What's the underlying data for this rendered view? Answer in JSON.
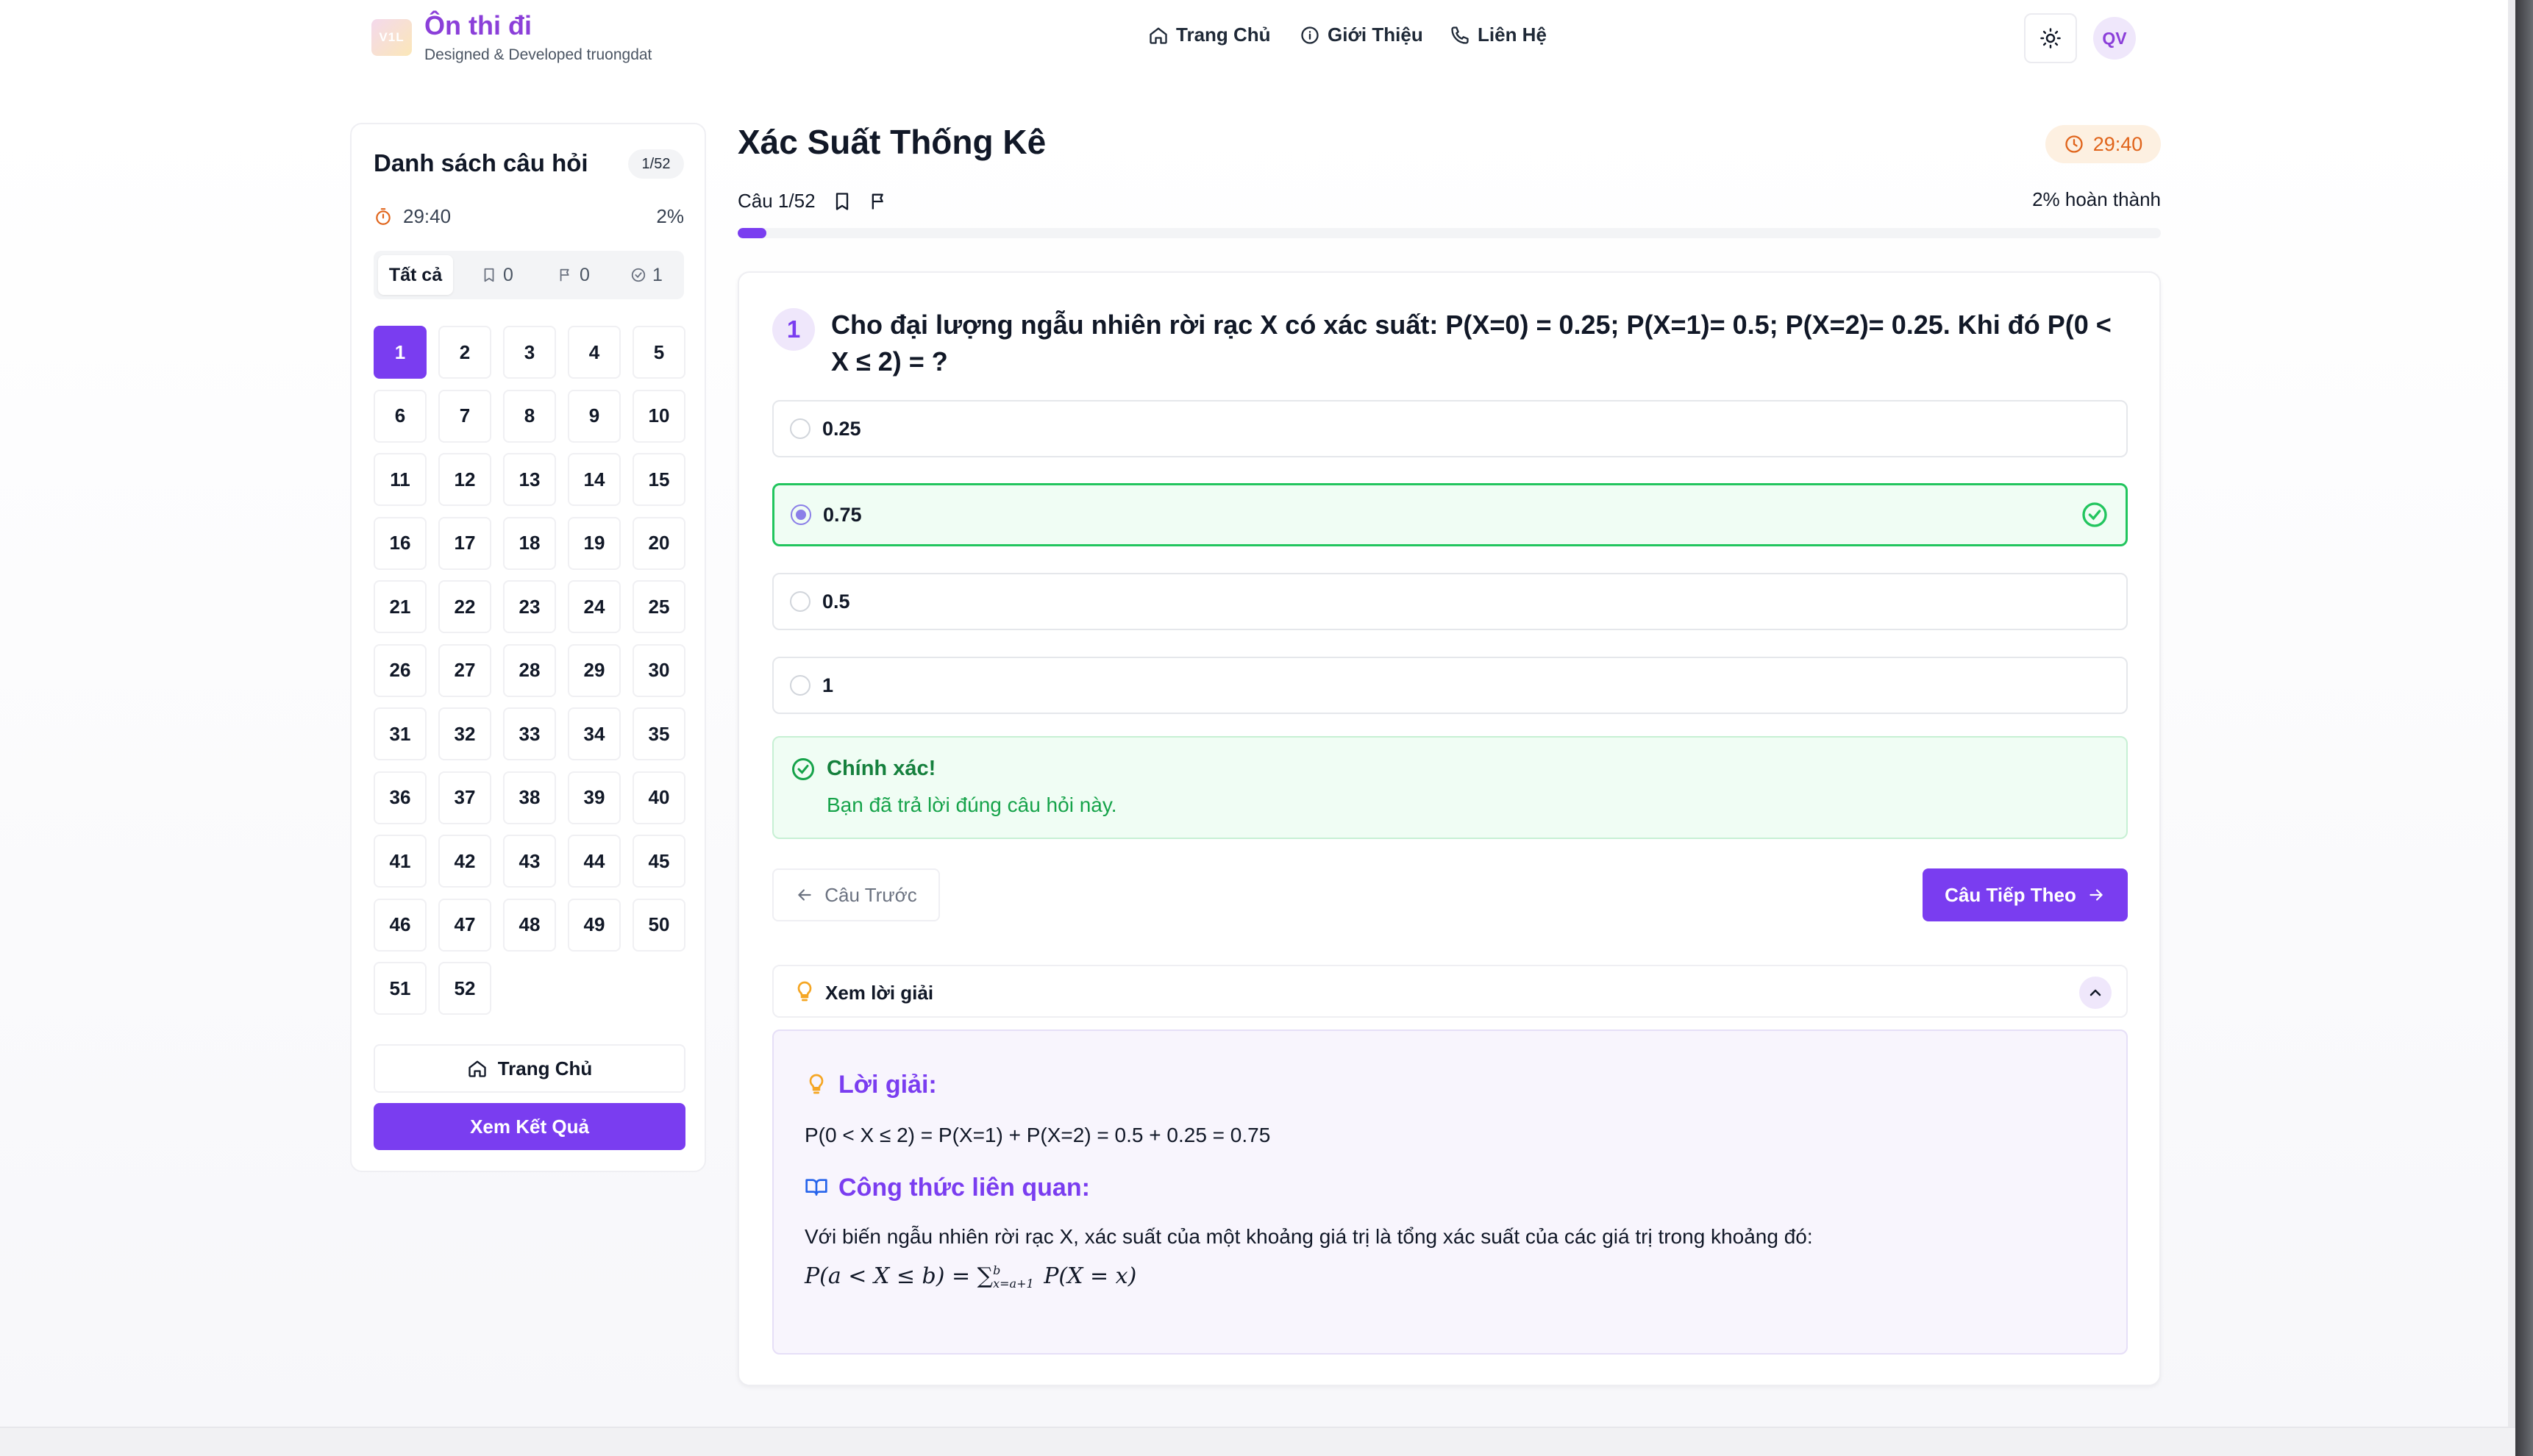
{
  "header": {
    "logo_text": "V1L",
    "brand_title": "Ôn thi đi",
    "brand_sub": "Designed & Developed truongdat",
    "nav": [
      "Trang Chủ",
      "Giới Thiệu",
      "Liên Hệ"
    ],
    "avatar": "QV"
  },
  "sidebar": {
    "title": "Danh sách câu hỏi",
    "count_badge": "1/52",
    "timer": "29:40",
    "percent": "2%",
    "filters": {
      "all_label": "Tất cả",
      "bookmarked_count": "0",
      "flagged_count": "0",
      "answered_count": "1"
    },
    "questions": [
      "1",
      "2",
      "3",
      "4",
      "5",
      "6",
      "7",
      "8",
      "9",
      "10",
      "11",
      "12",
      "13",
      "14",
      "15",
      "16",
      "17",
      "18",
      "19",
      "20",
      "21",
      "22",
      "23",
      "24",
      "25",
      "26",
      "27",
      "28",
      "29",
      "30",
      "31",
      "32",
      "33",
      "34",
      "35",
      "36",
      "37",
      "38",
      "39",
      "40",
      "41",
      "42",
      "43",
      "44",
      "45",
      "46",
      "47",
      "48",
      "49",
      "50",
      "51",
      "52"
    ],
    "active_question": 1,
    "home_label": "Trang Chủ",
    "result_label": "Xem Kết Quả"
  },
  "main": {
    "title": "Xác Suất Thống Kê",
    "timer": "29:40",
    "question_label": "Câu 1/52",
    "progress_text": "2% hoàn thành",
    "progress_fraction": 0.02,
    "question_number": "1",
    "question_text": "Cho đại lượng ngẫu nhiên rời rạc X có xác suất: P(X=0) = 0.25; P(X=1)= 0.5; P(X=2)= 0.25. Khi đó P(0 < X ≤ 2) = ?",
    "options": [
      "0.25",
      "0.75",
      "0.5",
      "1"
    ],
    "selected_option": 1,
    "feedback_title": "Chính xác!",
    "feedback_text": "Bạn đã trả lời đúng câu hỏi này.",
    "prev_label": "Câu Trước",
    "next_label": "Câu Tiếp Theo",
    "solution_toggle": "Xem lời giải",
    "solution": {
      "heading": "Lời giải:",
      "text": "P(0 < X ≤ 2) = P(X=1) + P(X=2) = 0.5 + 0.25 = 0.75",
      "formula_heading": "Công thức liên quan:",
      "formula_desc": "Với biến ngẫu nhiên rời rạc X, xác suất của một khoảng giá trị là tổng xác suất của các giá trị trong khoảng đó:",
      "formula_lhs": "P(a < X ≤ b) = ",
      "formula_sum": "∑",
      "formula_sup": "b",
      "formula_sub": "x=a+1",
      "formula_rhs": " P(X = x)"
    }
  },
  "colors": {
    "accent": "#7a3df0",
    "brand": "#8b3fd9",
    "success": "#22c55e",
    "timer": "#e0641b"
  }
}
